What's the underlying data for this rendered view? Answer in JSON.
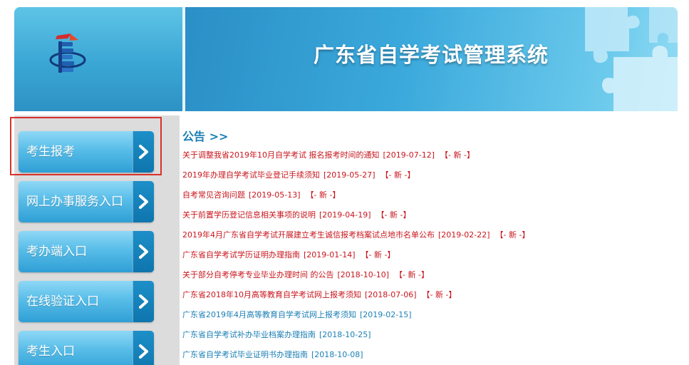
{
  "header": {
    "title": "广东省自学考试管理系统",
    "logo_icon": "exam-authority-logo-icon"
  },
  "sidebar": {
    "items": [
      {
        "label": "考生报考",
        "selected": true
      },
      {
        "label": "网上办事服务入口"
      },
      {
        "label": "考办端入口"
      },
      {
        "label": "在线验证入口"
      },
      {
        "label": "考生入口"
      }
    ],
    "arrow_icon": "chevron-right-icon"
  },
  "notices": {
    "heading": "公告 >>",
    "items": [
      {
        "text": "关于调整我省2019年10月自学考试 报名报考时间的通知",
        "date": "[2019-07-12]",
        "badge": "【- 新 -】",
        "color": "red"
      },
      {
        "text": "2019年办理自学考试毕业登记手续须知",
        "date": "[2019-05-27]",
        "badge": "【- 新 -】",
        "color": "red"
      },
      {
        "text": "自考常见咨询问题",
        "date": "[2019-05-13]",
        "badge": "【- 新 -】",
        "color": "red"
      },
      {
        "text": "关于前置学历登记信息相关事项的说明",
        "date": "[2019-04-19]",
        "badge": "【- 新 -】",
        "color": "red"
      },
      {
        "text": "2019年4月广东省自学考试开展建立考生诚信报考档案试点地市名单公布",
        "date": "[2019-02-22]",
        "badge": "【- 新 -】",
        "color": "red"
      },
      {
        "text": "广东省自学考试学历证明办理指南",
        "date": "[2019-01-14]",
        "badge": "【- 新 -】",
        "color": "red"
      },
      {
        "text": "关于部分自考停考专业毕业办理时间 的公告",
        "date": "[2018-10-10]",
        "badge": "【- 新 -】",
        "color": "red"
      },
      {
        "text": "广东省2018年10月高等教育自学考试网上报考须知",
        "date": "[2018-07-06]",
        "badge": "【- 新 -】",
        "color": "red"
      },
      {
        "text": "广东省2019年4月高等教育自学考试网上报考须知",
        "date": "[2019-02-15]",
        "badge": "",
        "color": "blue"
      },
      {
        "text": "广东省自学考试补办毕业档案办理指南",
        "date": "[2018-10-25]",
        "badge": "",
        "color": "blue"
      },
      {
        "text": "广东省自学考试毕业证明书办理指南",
        "date": "[2018-10-08]",
        "badge": "",
        "color": "blue"
      }
    ]
  },
  "colors": {
    "accent_blue": "#1a7fb4",
    "notice_red": "#c8161d",
    "highlight_red": "#d9312b",
    "sidebar_bg": "#dcdcdc"
  }
}
